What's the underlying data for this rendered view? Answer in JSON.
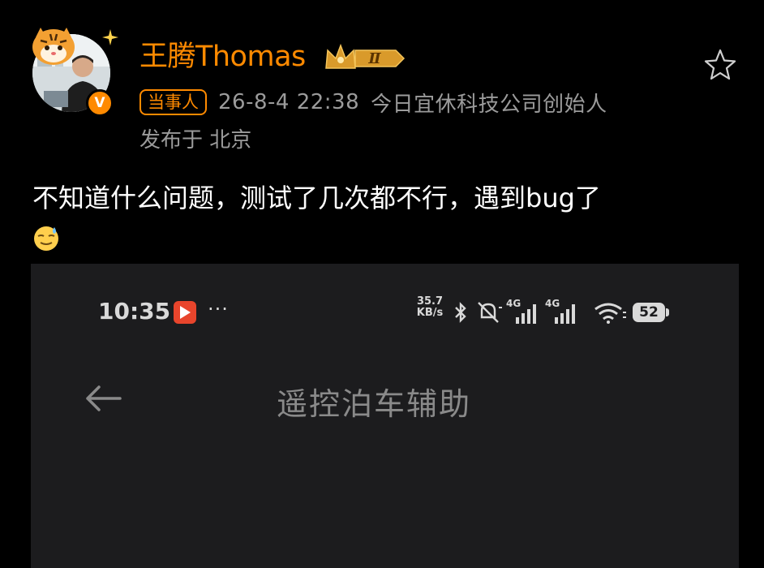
{
  "post": {
    "author_name": "王腾Thomas",
    "author_level": "Ⅱ",
    "role_tag": "当事人",
    "timestamp": "26-8-4 22:38",
    "author_title": "今日宜休科技公司创始人",
    "location": "发布于 北京",
    "text": "不知道什么问题，测试了几次都不行，遇到bug了",
    "emoji": "sweat-smile-emoji",
    "verified_badge": "V"
  },
  "icons": {
    "avatar": "avatar-photo",
    "tiger": "tiger-sticker-icon",
    "crown": "crown-level-badge-icon",
    "star": "star-outline-icon",
    "back": "back-arrow-icon"
  },
  "screenshot": {
    "status_bar": {
      "time": "10:35",
      "more": "···",
      "speed_value": "35.7",
      "speed_unit": "KB/s",
      "network_1": "4G",
      "network_2": "4G",
      "battery": "52"
    },
    "page_title": "遥控泊车辅助"
  },
  "colors": {
    "accent": "#ff8a00",
    "background": "#000000",
    "meta_gray": "#9b9b9b",
    "embedded_bg": "#1c1c1e"
  }
}
